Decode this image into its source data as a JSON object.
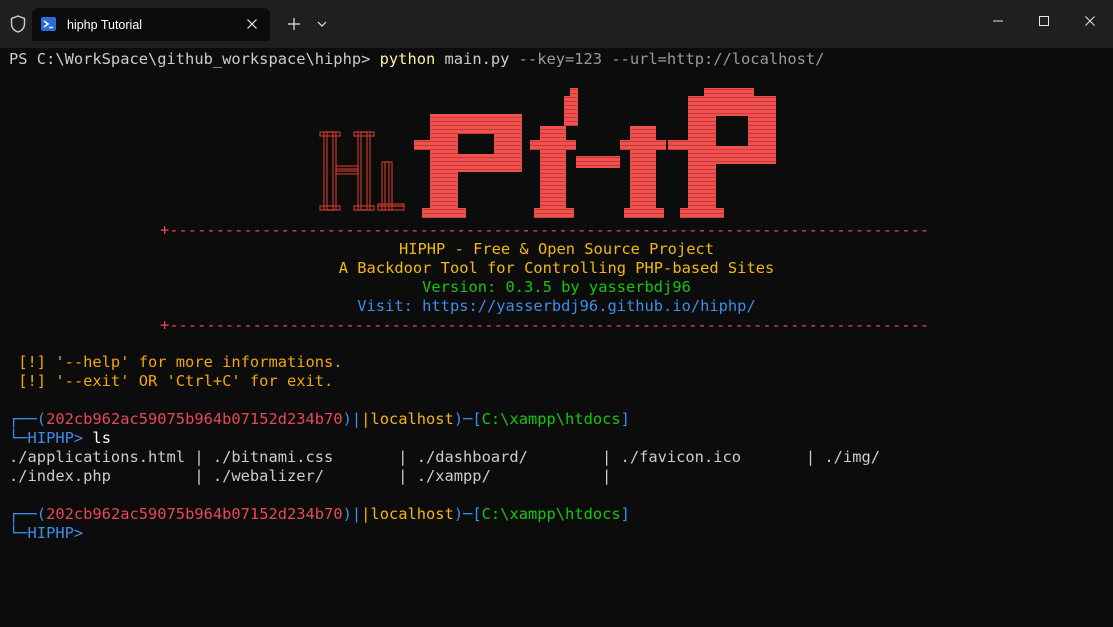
{
  "window": {
    "tab_title": "hiphp Tutorial",
    "new_tab_symbol": "+",
    "icons": [
      "shield-icon",
      "terminal-icon",
      "close-icon",
      "plus-icon",
      "chevron-down-icon",
      "minimize-icon",
      "maximize-icon",
      "close-window-icon"
    ]
  },
  "terminal": {
    "command_line": {
      "prompt": "PS C:\\WorkSpace\\github_workspace\\hiphp> ",
      "program": "python",
      "script": " main.py",
      "args": " --key=123 --url=http://localhost/"
    },
    "logo": {
      "left_text": "Hi",
      "right_text": "PHP"
    },
    "banner": {
      "rule": "+--------------------------------------------------------------------------------------------+",
      "title": "HIPHP - Free & Open Source Project",
      "subtitle": "A Backdoor Tool for Controlling PHP-based Sites",
      "version": "Version: 0.3.5 by yasserbdj96",
      "visit_label": "Visit: ",
      "visit_url": "https://yasserbdj96.github.io/hiphp/"
    },
    "hints": [
      " [!] '--help' for more informations.",
      " [!] '--exit' OR 'Ctrl+C' for exit."
    ],
    "session_prompt": {
      "corner_top": "┌──(",
      "session_id": "202cb962ac59075b964b07152d234b70",
      "sep1": ")|",
      "bar": "|",
      "host": "localhost",
      "sep2": ")─[",
      "path": "C:\\xampp\\htdocs",
      "close": "]",
      "corner_bottom": "└─",
      "label": "HIPHP> "
    },
    "first_command": "ls",
    "ls_output": [
      "./applications.html | ./bitnami.css       | ./dashboard/        | ./favicon.ico       | ./img/",
      "./index.php         | ./webalizer/        | ./xampp/            |"
    ]
  },
  "colors": {
    "background": "#0c0c0c",
    "titlebar": "#1f1f1f",
    "logo_red": "#f0524f",
    "logo_outline": "#c0392b",
    "session_red": "#e74856",
    "prompt_blue": "#3b8eea",
    "host_yellow": "#f2b80c",
    "path_green": "#16c60c",
    "version_green": "#16c60c"
  }
}
